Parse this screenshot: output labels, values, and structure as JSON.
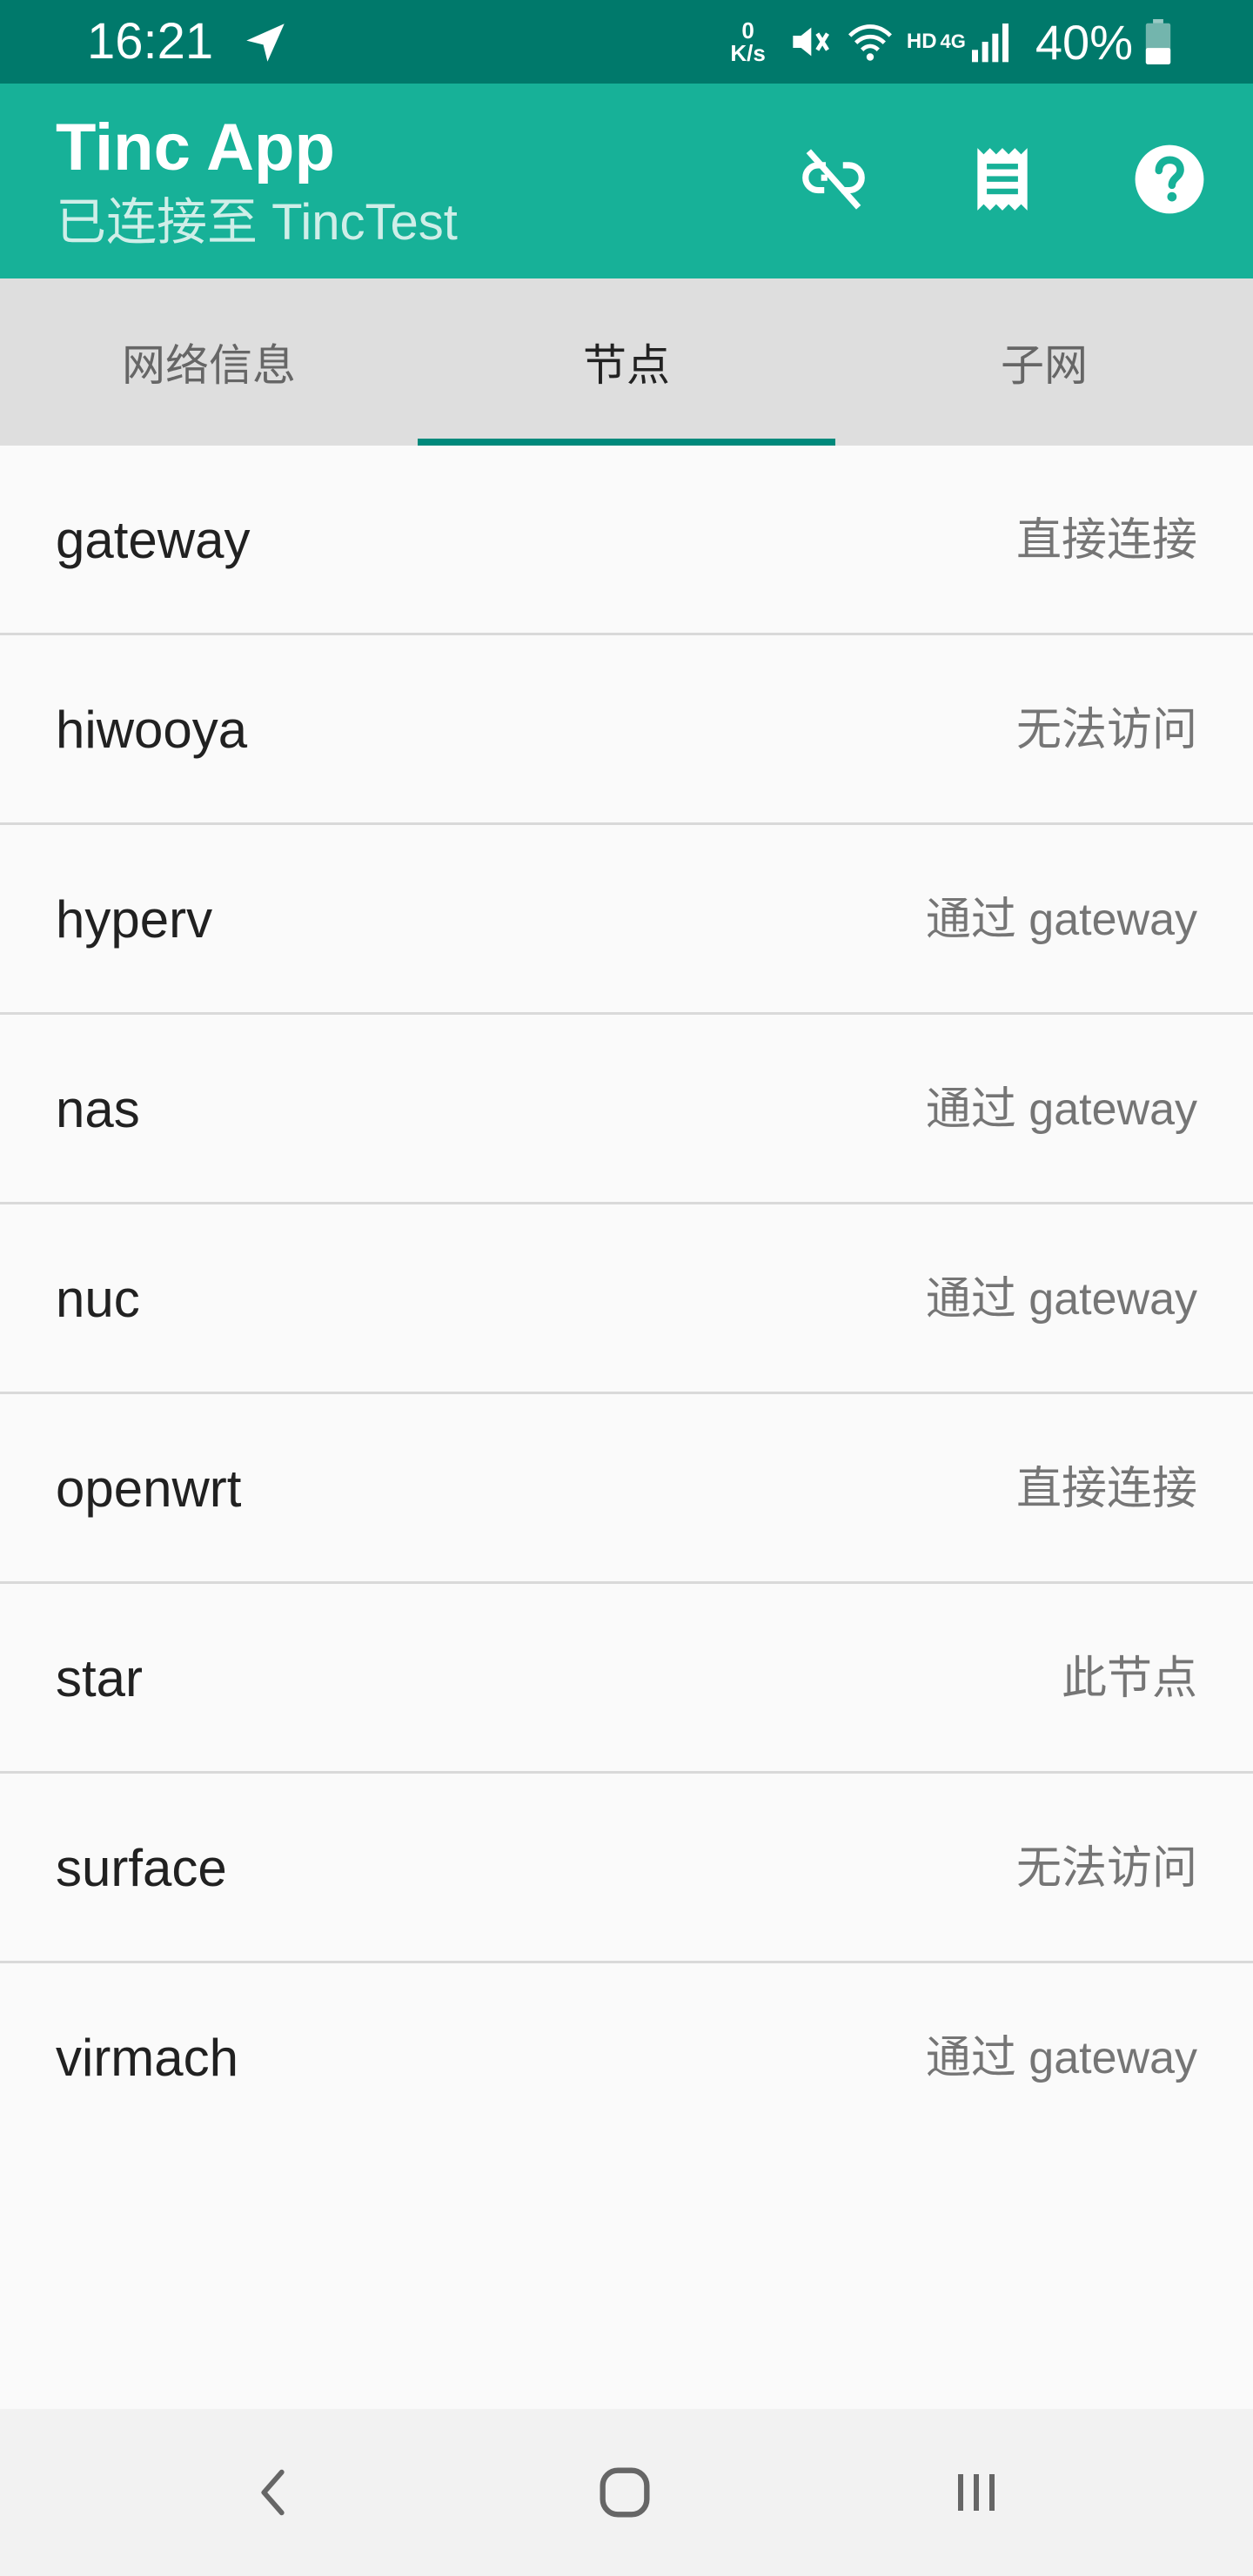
{
  "status_bar": {
    "time": "16:21",
    "speed_value": "0",
    "speed_unit": "K/s",
    "hd": "HD",
    "network": "4G",
    "battery": "40%",
    "icons": [
      "navigation-icon",
      "mute-icon",
      "wifi-icon",
      "signal-icon",
      "battery-icon"
    ]
  },
  "app_bar": {
    "title": "Tinc App",
    "subtitle": "已连接至 TincTest",
    "background_color": "#17b198",
    "actions": [
      "disconnect-icon",
      "log-icon",
      "help-icon"
    ]
  },
  "tabs": [
    {
      "label": "网络信息",
      "active": false
    },
    {
      "label": "节点",
      "active": true
    },
    {
      "label": "子网",
      "active": false
    }
  ],
  "accent_color": "#00897b",
  "nodes": [
    {
      "name": "gateway",
      "status": "直接连接"
    },
    {
      "name": "hiwooya",
      "status": "无法访问"
    },
    {
      "name": "hyperv",
      "status": "通过 gateway"
    },
    {
      "name": "nas",
      "status": "通过 gateway"
    },
    {
      "name": "nuc",
      "status": "通过 gateway"
    },
    {
      "name": "openwrt",
      "status": "直接连接"
    },
    {
      "name": "star",
      "status": "此节点"
    },
    {
      "name": "surface",
      "status": "无法访问"
    },
    {
      "name": "virmach",
      "status": "通过 gateway"
    }
  ],
  "nav_bar": {
    "buttons": [
      "back-icon",
      "home-icon",
      "recents-icon"
    ]
  }
}
